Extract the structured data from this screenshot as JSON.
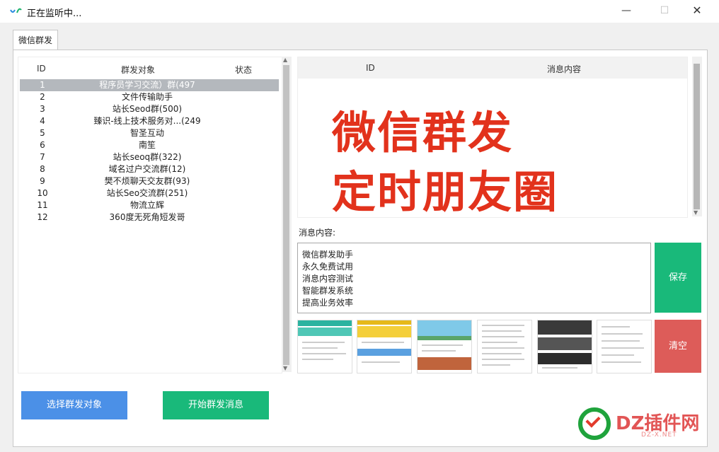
{
  "window": {
    "title": "正在监听中...",
    "min_glyph": "—",
    "max_glyph": "☐",
    "close_glyph": "✕"
  },
  "tab": {
    "label": "微信群发"
  },
  "targets": {
    "headers": {
      "id": "ID",
      "target": "群发对象",
      "status": "状态"
    },
    "rows": [
      {
        "id": "1",
        "name": "程序员学习交流）群(497"
      },
      {
        "id": "2",
        "name": "文件传输助手"
      },
      {
        "id": "3",
        "name": "站长Seod群(500)"
      },
      {
        "id": "4",
        "name": "臻识-线上技术服务对...(249"
      },
      {
        "id": "5",
        "name": "智圣互动"
      },
      {
        "id": "6",
        "name": "南笙"
      },
      {
        "id": "7",
        "name": "站长seoq群(322)"
      },
      {
        "id": "8",
        "name": "域名过户交流群(12)"
      },
      {
        "id": "9",
        "name": "樊不烦聊天交友群(93)"
      },
      {
        "id": "10",
        "name": "站长Seo交流群(251)"
      },
      {
        "id": "11",
        "name": "物流立辉"
      },
      {
        "id": "12",
        "name": "360度无死角短发哥"
      }
    ]
  },
  "messages": {
    "headers": {
      "id": "ID",
      "content": "消息内容"
    },
    "overlay_line1": "微信群发",
    "overlay_line2": "定时朋友圈"
  },
  "compose": {
    "label": "消息内容:",
    "lines": [
      "微信群发助手",
      "永久免费试用",
      "消息内容测试",
      "智能群发系统",
      "提高业务效率"
    ]
  },
  "buttons": {
    "save": "保存",
    "clear": "清空",
    "select_targets": "选择群发对象",
    "start_send": "开始群发消息"
  },
  "watermark": {
    "text": "DZ插件网",
    "sub": "DZ-X.NET"
  },
  "colors": {
    "green": "#19b97a",
    "red": "#dd5c59",
    "blue": "#4b90e7",
    "overlay_red": "#e2321c"
  }
}
